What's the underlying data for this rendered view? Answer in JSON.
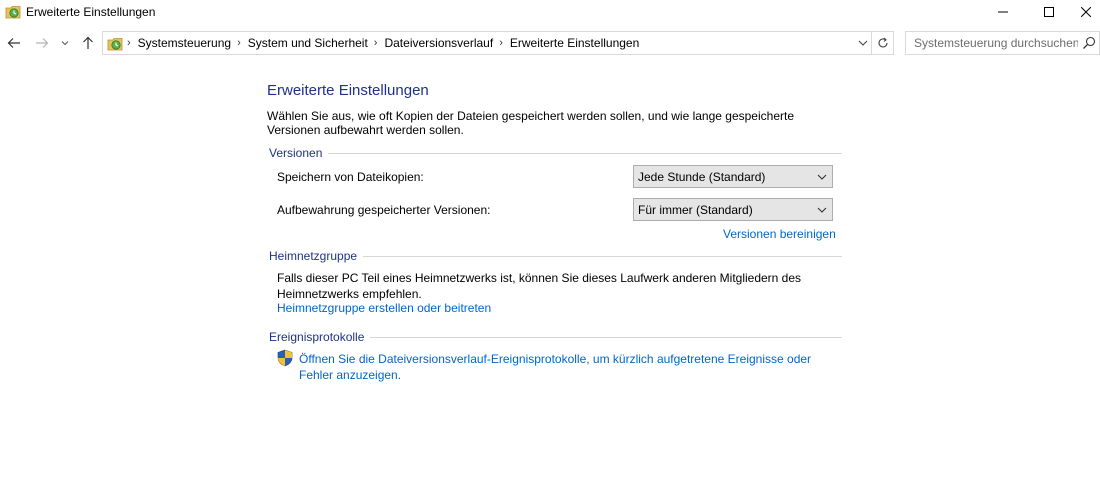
{
  "window": {
    "title": "Erweiterte Einstellungen"
  },
  "nav": {
    "breadcrumbs": [
      "Systemsteuerung",
      "System und Sicherheit",
      "Dateiversionsverlauf",
      "Erweiterte Einstellungen"
    ],
    "search_placeholder": "Systemsteuerung durchsuchen"
  },
  "page": {
    "title": "Erweiterte Einstellungen",
    "intro": "Wählen Sie aus, wie oft Kopien der Dateien gespeichert werden sollen, und wie lange gespeicherte Versionen aufbewahrt werden sollen."
  },
  "versions": {
    "heading": "Versionen",
    "save_label": "Speichern von Dateikopien:",
    "save_value": "Jede Stunde (Standard)",
    "keep_label": "Aufbewahrung gespeicherter Versionen:",
    "keep_value": "Für immer (Standard)",
    "cleanup_link": "Versionen bereinigen"
  },
  "homegroup": {
    "heading": "Heimnetzgruppe",
    "text": "Falls dieser PC Teil eines Heimnetzwerks ist, können Sie dieses Laufwerk anderen Mitgliedern des Heimnetzwerks empfehlen.",
    "link": "Heimnetzgruppe erstellen oder beitreten"
  },
  "events": {
    "heading": "Ereignisprotokolle",
    "link": "Öffnen Sie die Dateiversionsverlauf-Ereignisprotokolle, um kürzlich aufgetretene Ereignisse oder Fehler anzuzeigen."
  },
  "icons": {
    "app": "file-history-icon",
    "back": "arrow-left-icon",
    "forward": "arrow-right-icon",
    "recent": "chevron-down-icon",
    "up": "arrow-up-icon",
    "refresh": "refresh-icon",
    "search": "search-icon",
    "shield": "uac-shield-icon"
  },
  "colors": {
    "heading": "#1e3287",
    "link": "#0066cc",
    "rule": "#d6d6d6"
  }
}
